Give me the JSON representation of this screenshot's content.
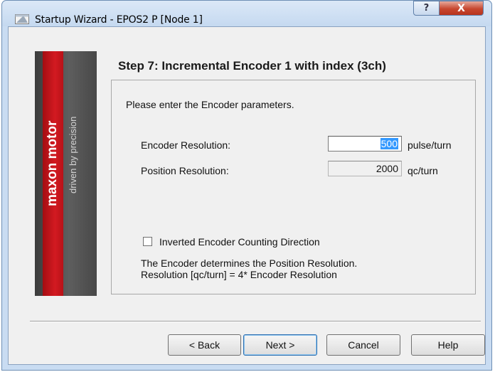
{
  "window": {
    "title": "Startup Wizard - EPOS2 P [Node 1]",
    "help_glyph": "?",
    "close_glyph": "X"
  },
  "banner": {
    "brand": "maxon motor",
    "tagline": "driven by precision"
  },
  "step": {
    "title": "Step 7: Incremental Encoder 1 with index (3ch)"
  },
  "form": {
    "intro": "Please enter the Encoder parameters.",
    "encoder_resolution": {
      "label": "Encoder Resolution:",
      "value": "500",
      "unit": "pulse/turn"
    },
    "position_resolution": {
      "label": "Position Resolution:",
      "value": "2000",
      "unit": "qc/turn"
    },
    "inverted_checkbox": {
      "label": "Inverted Encoder Counting Direction",
      "checked": false
    },
    "note_line1": "The Encoder determines the Position Resolution.",
    "note_line2": "Resolution [qc/turn] = 4* Encoder Resolution"
  },
  "buttons": {
    "back": "< Back",
    "next": "Next >",
    "cancel": "Cancel",
    "help": "Help"
  },
  "colors": {
    "brand_red": "#d31a21",
    "selection": "#3399ff"
  }
}
